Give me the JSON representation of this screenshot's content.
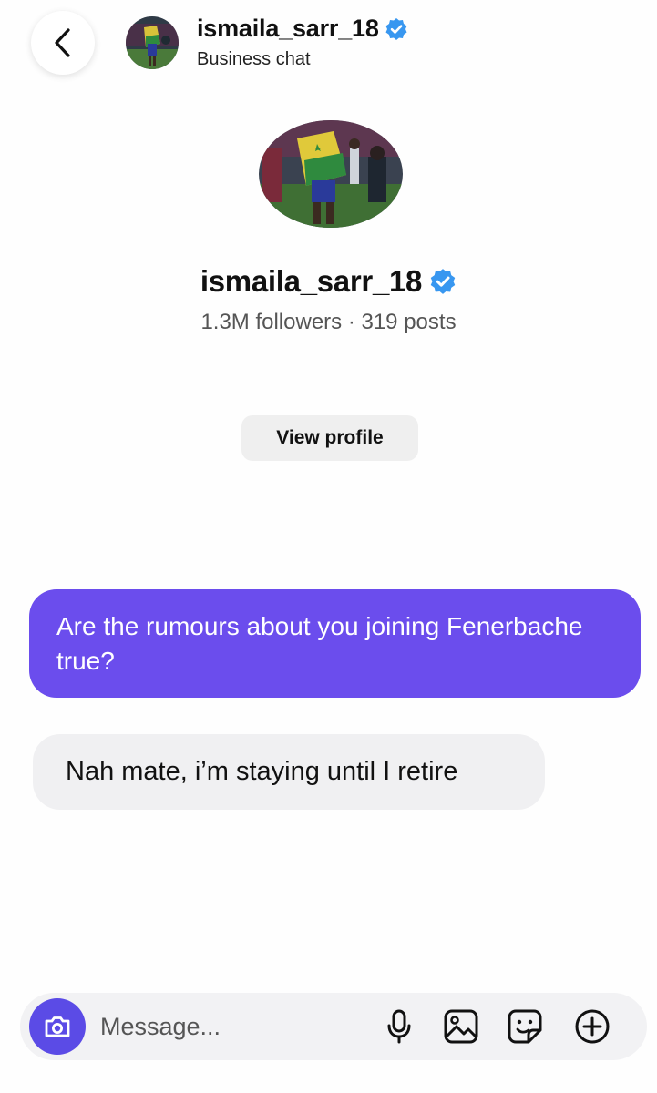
{
  "header": {
    "back_icon": "chevron-left-icon",
    "username": "ismaila_sarr_18",
    "subtitle": "Business chat",
    "verified_icon": "verified-badge-icon",
    "verified_color": "#3897f0"
  },
  "profile": {
    "username": "ismaila_sarr_18",
    "stats": "1.3M followers · 319 posts",
    "view_profile_label": "View profile"
  },
  "messages": [
    {
      "direction": "sent",
      "text": "Are the rumours about you joining Fenerbache true?"
    },
    {
      "direction": "received",
      "text": "Nah mate, i’m staying until I retire"
    }
  ],
  "composer": {
    "placeholder": "Message...",
    "icons": [
      "camera-icon",
      "microphone-icon",
      "gallery-icon",
      "sticker-icon",
      "add-icon"
    ]
  },
  "colors": {
    "sent_bubble": "#6b4ded",
    "received_bubble": "#f0f0f2",
    "camera_button": "#5b4be6"
  }
}
